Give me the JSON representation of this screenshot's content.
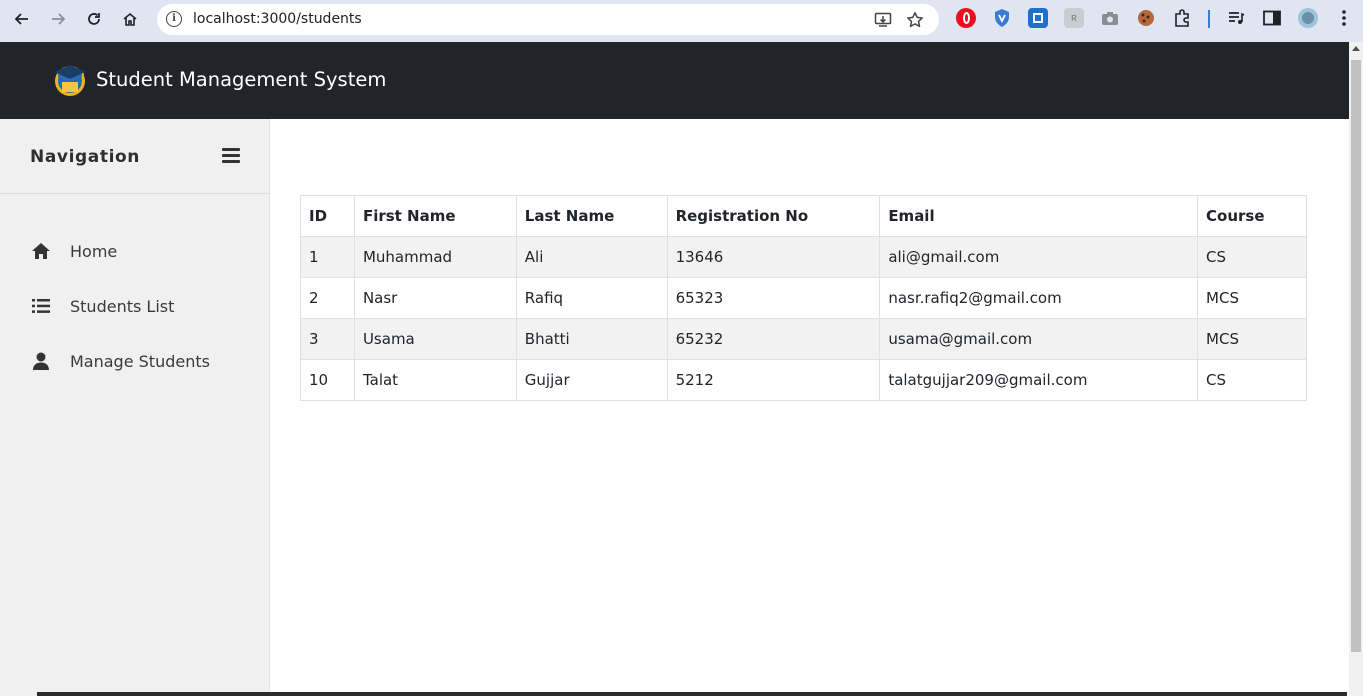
{
  "browser": {
    "url": "localhost:3000/students",
    "colors": {
      "toolbar": "#dfe6f2",
      "omnibox": "#ffffff"
    },
    "extensions": [
      "opera-icon",
      "shield-icon",
      "screenshot-icon",
      "ext-icon",
      "camera-icon",
      "cookie-icon",
      "puzzle-icon"
    ]
  },
  "header": {
    "title": "Student Management System",
    "background": "#212529"
  },
  "sidebar": {
    "title": "Navigation",
    "items": [
      {
        "label": "Home",
        "icon": "home-icon"
      },
      {
        "label": "Students List",
        "icon": "list-icon"
      },
      {
        "label": "Manage Students",
        "icon": "user-icon"
      }
    ]
  },
  "table": {
    "columns": [
      "ID",
      "First Name",
      "Last Name",
      "Registration No",
      "Email",
      "Course"
    ],
    "rows": [
      [
        "1",
        "Muhammad",
        "Ali",
        "13646",
        "ali@gmail.com",
        "CS"
      ],
      [
        "2",
        "Nasr",
        "Rafiq",
        "65323",
        "nasr.rafiq2@gmail.com",
        "MCS"
      ],
      [
        "3",
        "Usama",
        "Bhatti",
        "65232",
        "usama@gmail.com",
        "MCS"
      ],
      [
        "10",
        "Talat",
        "Gujjar",
        "5212",
        "talatgujjar209@gmail.com",
        "CS"
      ]
    ]
  }
}
